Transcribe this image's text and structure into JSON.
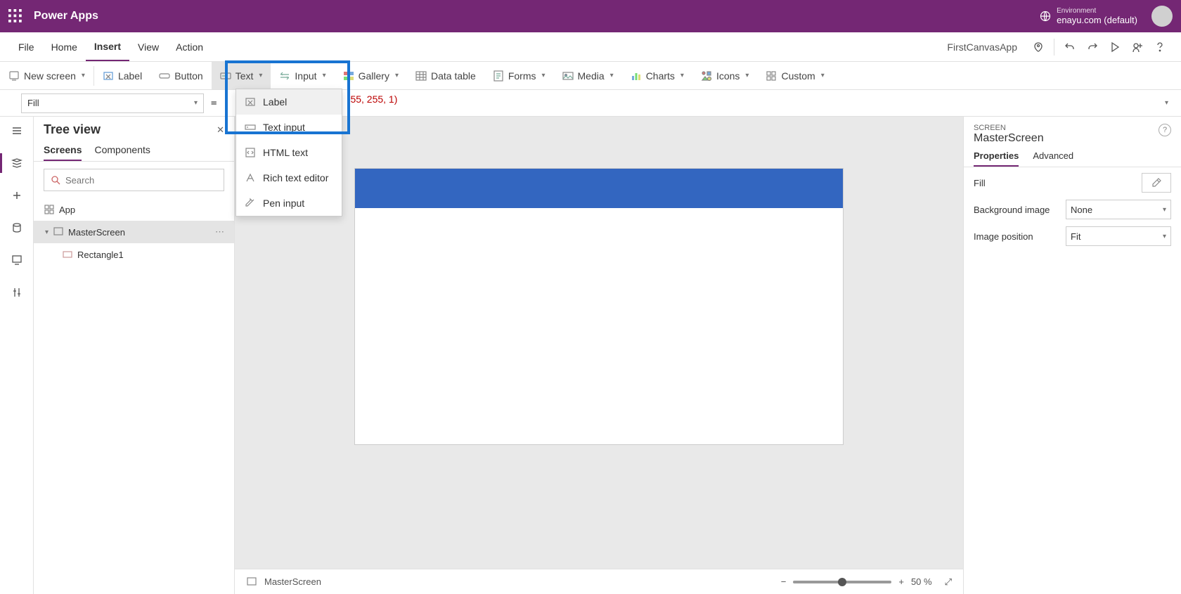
{
  "topbar": {
    "title": "Power Apps",
    "env_label": "Environment",
    "env_value": "enayu.com (default)"
  },
  "menubar": {
    "items": [
      "File",
      "Home",
      "Insert",
      "View",
      "Action"
    ],
    "active_index": 2,
    "app_name": "FirstCanvasApp"
  },
  "ribbon": {
    "new_screen": "New screen",
    "label": "Label",
    "button": "Button",
    "text": "Text",
    "input": "Input",
    "gallery": "Gallery",
    "data_table": "Data table",
    "forms": "Forms",
    "media": "Media",
    "charts": "Charts",
    "icons": "Icons",
    "custom": "Custom"
  },
  "ribbon_dropdown": {
    "items": [
      {
        "label": "Label",
        "icon": "label-icon"
      },
      {
        "label": "Text input",
        "icon": "text-input-icon"
      },
      {
        "label": "HTML text",
        "icon": "html-text-icon"
      },
      {
        "label": "Rich text editor",
        "icon": "rich-text-icon"
      },
      {
        "label": "Pen input",
        "icon": "pen-input-icon"
      }
    ]
  },
  "formula_bar": {
    "property": "Fill",
    "expression_visible": "55, 255, 1)",
    "eq": "="
  },
  "tree": {
    "title": "Tree view",
    "tabs": [
      "Screens",
      "Components"
    ],
    "active_tab": 0,
    "search_placeholder": "Search",
    "nodes": {
      "app": "App",
      "master": "MasterScreen",
      "rect": "Rectangle1"
    }
  },
  "canvas": {
    "footer_screen": "MasterScreen",
    "zoom": "50 %"
  },
  "prop": {
    "kind": "SCREEN",
    "name": "MasterScreen",
    "tabs": [
      "Properties",
      "Advanced"
    ],
    "active_tab": 0,
    "rows": {
      "fill": "Fill",
      "bg_image": "Background image",
      "bg_image_value": "None",
      "img_pos": "Image position",
      "img_pos_value": "Fit"
    }
  }
}
